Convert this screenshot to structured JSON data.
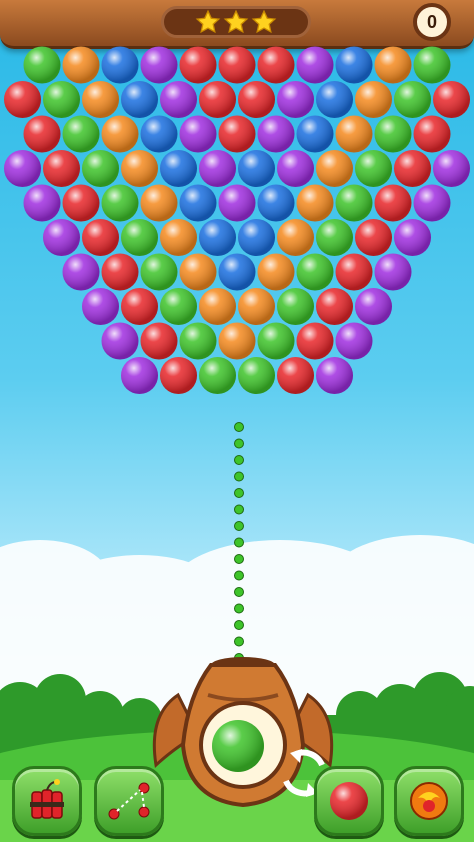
{
  "header": {
    "stars_earned": 3,
    "stars_total": 3,
    "score": "0"
  },
  "bubble_rows": [
    [
      "green",
      "orange",
      "blue",
      "purple",
      "red",
      "red",
      "red",
      "purple",
      "blue",
      "orange",
      "green"
    ],
    [
      "red",
      "green",
      "orange",
      "blue",
      "purple",
      "red",
      "red",
      "purple",
      "blue",
      "orange",
      "green",
      "red"
    ],
    [
      "red",
      "green",
      "orange",
      "blue",
      "purple",
      "red",
      "purple",
      "blue",
      "orange",
      "green",
      "red"
    ],
    [
      "purple",
      "red",
      "green",
      "orange",
      "blue",
      "purple",
      "blue",
      "purple",
      "orange",
      "green",
      "red",
      "purple"
    ],
    [
      "purple",
      "red",
      "green",
      "orange",
      "blue",
      "purple",
      "blue",
      "orange",
      "green",
      "red",
      "purple"
    ],
    [
      "purple",
      "red",
      "green",
      "orange",
      "blue",
      "blue",
      "orange",
      "green",
      "red",
      "purple"
    ],
    [
      "purple",
      "red",
      "green",
      "orange",
      "blue",
      "orange",
      "green",
      "red",
      "purple"
    ],
    [
      "purple",
      "red",
      "green",
      "orange",
      "orange",
      "green",
      "red",
      "purple"
    ],
    [
      "purple",
      "red",
      "green",
      "orange",
      "green",
      "red",
      "purple"
    ],
    [
      "purple",
      "red",
      "green",
      "green",
      "red",
      "purple"
    ]
  ],
  "colors": {
    "red": "#e8262a",
    "green": "#3ec42a",
    "orange": "#f58a1f",
    "blue": "#1a6fe0",
    "purple": "#a02ee0",
    "sky_top": "#28b8e6",
    "wood": "#8b4a1f"
  },
  "shooter": {
    "loaded_bubble": "green",
    "next_bubble": "red"
  },
  "icons": {
    "dynamite": "dynamite-icon",
    "aim_line": "aim-guide-icon",
    "swap": "swap-arrows-icon",
    "fireball": "fireball-icon"
  }
}
